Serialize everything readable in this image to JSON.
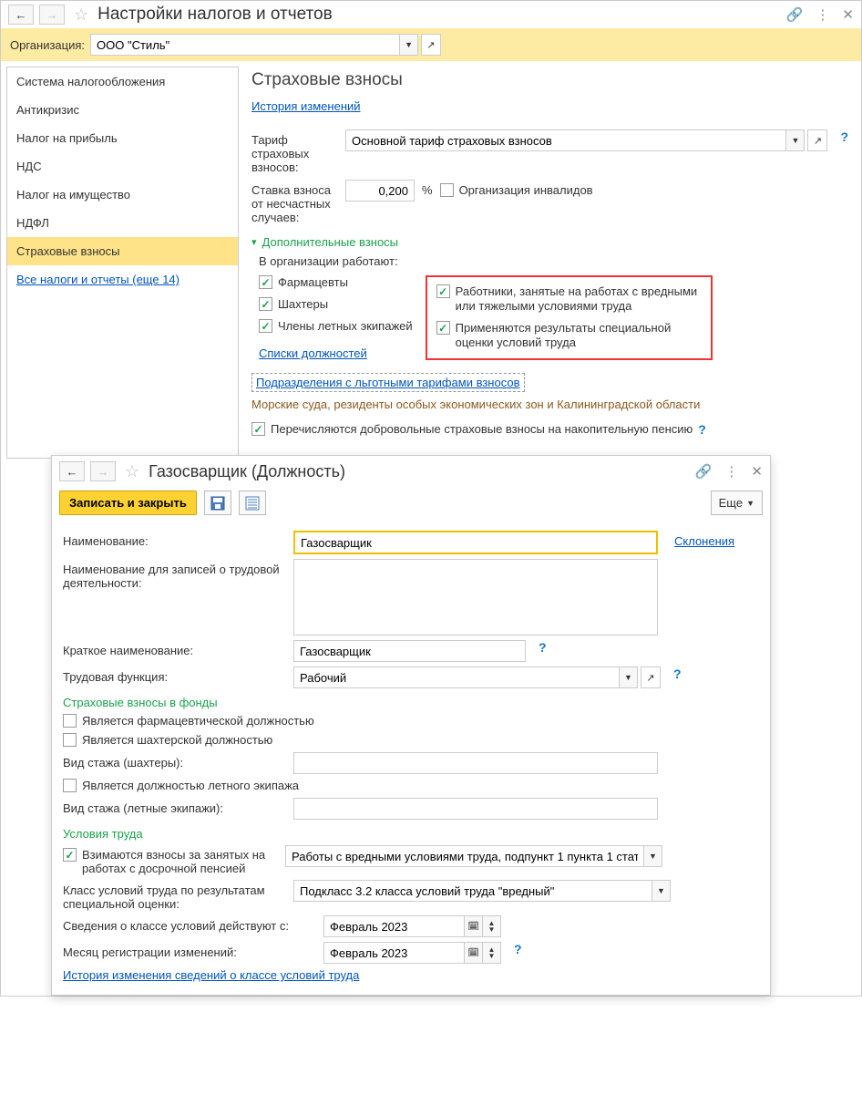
{
  "window": {
    "title": "Настройки налогов и отчетов",
    "org_label": "Организация:",
    "org_value": "ООО \"Стиль\""
  },
  "sidebar": {
    "items": [
      "Система налогообложения",
      "Антикризис",
      "Налог на прибыль",
      "НДС",
      "Налог на имущество",
      "НДФЛ",
      "Страховые взносы"
    ],
    "link": "Все налоги и отчеты (еще 14)"
  },
  "main": {
    "heading": "Страховые взносы",
    "history_link": "История изменений",
    "tariff_label": "Тариф страховых взносов:",
    "tariff_value": "Основной тариф страховых взносов",
    "rate_label": "Ставка взноса от несчастных случаев:",
    "rate_value": "0,200",
    "percent": "%",
    "org_invalid": "Организация инвалидов",
    "expander": "Дополнительные взносы",
    "in_org_label": "В организации работают:",
    "left_checks": [
      "Фармацевты",
      "Шахтеры",
      "Члены летных экипажей"
    ],
    "right_checks": [
      "Работники, занятые на работах с вредными или тяжелыми условиями труда",
      "Применяются результаты специальной оценки условий труда"
    ],
    "positions_link": "Списки должностей",
    "dotted_link": "Подразделения с льготными тарифами взносов",
    "brown_text": "Морские суда, резиденты особых экономических зон и Калининградской области",
    "voluntary": "Перечисляются добровольные страховые взносы на накопительную пенсию"
  },
  "inner": {
    "title": "Газосварщик (Должность)",
    "save_close": "Записать и закрыть",
    "more": "Еще",
    "name_label": "Наименование:",
    "name_value": "Газосварщик",
    "declensions": "Склонения",
    "name_records_label": "Наименование для записей о трудовой деятельности:",
    "short_name_label": "Краткое наименование:",
    "short_name_value": "Газосварщик",
    "job_func_label": "Трудовая функция:",
    "job_func_value": "Рабочий",
    "funds_heading": "Страховые взносы в фонды",
    "is_pharma": "Является фармацевтической должностью",
    "is_miner": "Является шахтерской должностью",
    "miner_stage_label": "Вид стажа (шахтеры):",
    "is_flight": "Является должностью летного экипажа",
    "flight_stage_label": "Вид стажа (летные экипажи):",
    "conditions_heading": "Условия труда",
    "early_pension": "Взимаются взносы за занятых на работах с досрочной пенсией",
    "early_pension_value": "Работы с вредными условиями труда, подпункт 1 пункта 1 стат",
    "class_label": "Класс условий труда по результатам специальной оценки:",
    "class_value": "Подкласс 3.2 класса условий труда \"вредный\"",
    "info_from_label": "Сведения о классе условий действуют с:",
    "info_from_value": "Февраль 2023",
    "reg_month_label": "Месяц регистрации изменений:",
    "reg_month_value": "Февраль 2023",
    "history_link": "История изменения сведений о классе условий труда"
  }
}
